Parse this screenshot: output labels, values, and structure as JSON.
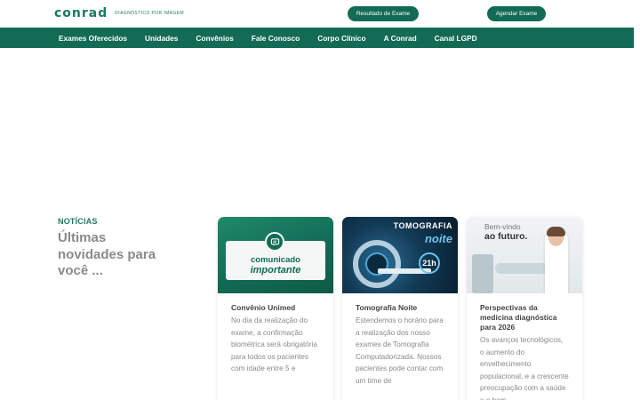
{
  "header": {
    "logo_text": "conrad",
    "logo_tagline": "diagnóstico por imagem",
    "result_button": "Resultado de Exame",
    "schedule_button": "Agendar Exame"
  },
  "nav": {
    "items": [
      "Exames Oferecidos",
      "Unidades",
      "Convênios",
      "Fale Conosco",
      "Corpo Clínico",
      "A Conrad",
      "Canal LGPD"
    ]
  },
  "news": {
    "kicker": "NOTÍCIAS",
    "title": "Últimas novidades para você ..."
  },
  "cards": [
    {
      "title": "Convênio Unimed",
      "text": "No dia da realização do exame, a confirmação biométrica será obrigatória para todos os pacientes com idade entre 5 e",
      "img_line1": "comunicado",
      "img_line2": "importante"
    },
    {
      "title": "Tomografia Noite",
      "text": "Estendemos o horário para a realização dos nosso exames de Tomografia Computadorizada. Nossos pacientes pode contar com um time de",
      "img_line1": "TOMOGRAFIA",
      "img_line2": "noite",
      "img_badge": "21h"
    },
    {
      "title": "Perspectivas da medicina diagnóstica para 2026",
      "text": "Os avanços tecnológicos, o aumento do envelhecimento populacional, e a crescente preocupação com a saúde e o bem-",
      "img_line1": "Bem-vindo",
      "img_line2": "ao futuro."
    }
  ],
  "colors": {
    "brand_green": "#136b55",
    "accent_green": "#1c7a5f",
    "muted_text": "#8a8a8a"
  }
}
